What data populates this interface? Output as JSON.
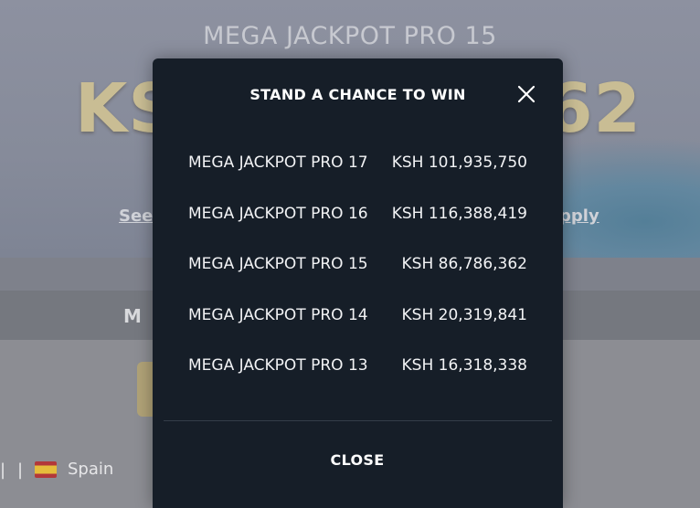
{
  "background": {
    "hero_title": "MEGA JACKPOT PRO 15",
    "hero_amount_left": "KS",
    "hero_amount_right": "62",
    "link_left": "See",
    "link_right": "pply",
    "section_label": "M",
    "footer_separator": "|",
    "country": "Spain",
    "flag_icon": "spain-flag-icon"
  },
  "modal": {
    "title": "STAND A CHANCE TO WIN",
    "close_icon": "close-icon",
    "close_label": "CLOSE",
    "jackpots": [
      {
        "name": "MEGA JACKPOT PRO 17",
        "amount": "KSH 101,935,750"
      },
      {
        "name": "MEGA JACKPOT PRO 16",
        "amount": "KSH 116,388,419"
      },
      {
        "name": "MEGA JACKPOT PRO 15",
        "amount": "KSH 86,786,362"
      },
      {
        "name": "MEGA JACKPOT PRO 14",
        "amount": "KSH 20,319,841"
      },
      {
        "name": "MEGA JACKPOT PRO 13",
        "amount": "KSH 16,318,338"
      }
    ]
  },
  "colors": {
    "modal_background": "#161e28",
    "hero_amount": "#c9bd94",
    "overlay": "#8a8d96"
  }
}
